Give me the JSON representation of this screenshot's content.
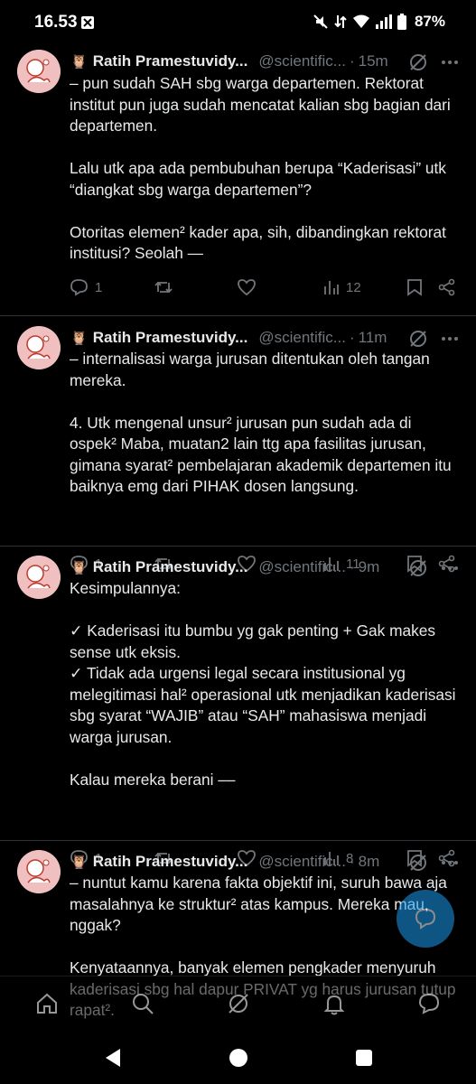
{
  "status_bar": {
    "time": "16.53",
    "battery": "87%"
  },
  "tweets": [
    {
      "author_name": "Ratih Pramestuvidy...",
      "handle": "@scientific...",
      "separator": "·",
      "time": "15m",
      "text": "– pun sudah SAH sbg warga departemen. Rektorat institut pun juga sudah mencatat kalian sbg bagian dari departemen.\n\nLalu utk apa ada pembubuhan berupa “Kaderisasi” utk “diangkat sbg warga departemen”?\n\nOtoritas elemen² kader apa, sih, dibandingkan rektorat institusi? Seolah —",
      "replies": "1",
      "retweets": "",
      "likes": "",
      "views": "12"
    },
    {
      "author_name": "Ratih Pramestuvidy...",
      "handle": "@scientific...",
      "separator": "·",
      "time": "11m",
      "text": "– internalisasi warga jurusan ditentukan oleh tangan mereka.\n\n4. Utk mengenal unsur² jurusan pun sudah ada di ospek² Maba, muatan2 lain ttg apa fasilitas jurusan, gimana syarat² pembelajaran akademik departemen itu baiknya emg dari PIHAK dosen langsung.",
      "replies": "1",
      "retweets": "",
      "likes": "",
      "views": "11"
    },
    {
      "author_name": "Ratih Pramestuvidy...",
      "handle": "@scientific...",
      "separator": "·",
      "time": "9m",
      "text": "Kesimpulannya:\n\n✓ Kaderisasi itu bumbu yg gak penting + Gak makes sense utk eksis.\n✓ Tidak ada urgensi legal secara institusional yg melegitimasi hal² operasional utk menjadikan kaderisasi sbg syarat “WAJIB” atau “SAH” mahasiswa menjadi warga jurusan.\n\nKalau mereka berani ––",
      "replies": "1",
      "retweets": "",
      "likes": "",
      "views": "8"
    },
    {
      "author_name": "Ratih Pramestuvidy...",
      "handle": "@scientific...",
      "separator": "·",
      "time": "8m",
      "text": "– nuntut kamu karena fakta objektif ini, suruh bawa aja masalahnya ke struktur² atas kampus. Mereka mau, nggak?\n\nKenyataannya, banyak elemen pengkader menyuruh kaderisasi sbg hal dapur PRIVAT yg harus jurusan tutup rapat².",
      "replies": "",
      "retweets": "",
      "likes": "",
      "views": ""
    }
  ],
  "icons": {
    "reply": "reply-icon",
    "retweet": "retweet-icon",
    "like": "like-icon",
    "views": "views-icon",
    "bookmark": "bookmark-icon",
    "share": "share-icon",
    "grok": "grok-icon",
    "more": "more-icon"
  },
  "colors": {
    "background": "#000000",
    "text": "#e7e9ea",
    "secondary": "#71767b",
    "accent": "#1d9bf0"
  }
}
